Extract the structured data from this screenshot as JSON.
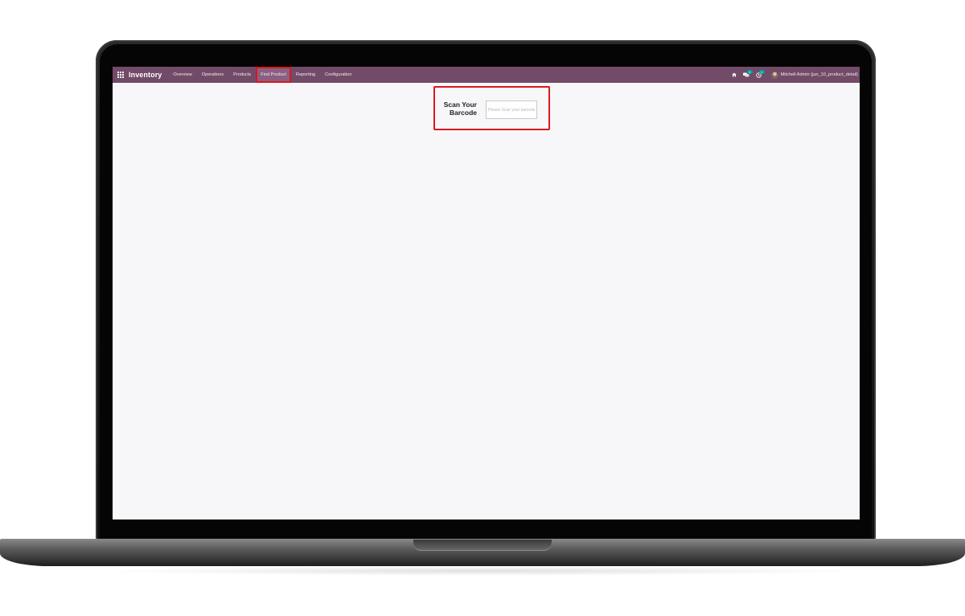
{
  "navbar": {
    "apps_icon": "grid-icon",
    "brand": "Inventory",
    "color": "#714b67",
    "menu": [
      {
        "label": "Overview"
      },
      {
        "label": "Operations"
      },
      {
        "label": "Products"
      },
      {
        "label": "Find Product",
        "highlighted": true
      },
      {
        "label": "Reporting"
      },
      {
        "label": "Configuration"
      }
    ],
    "right": {
      "icons": [
        "home-icon",
        "chat-icon",
        "activity-icon"
      ],
      "chat_badge": "4",
      "activity_badge": "1",
      "user_name": "Mitchell Admin (jun_10_product_detail)"
    }
  },
  "scan": {
    "label": "Scan Your Barcode",
    "placeholder": "Please Scan your barcode",
    "highlight_color": "#d8171f"
  }
}
